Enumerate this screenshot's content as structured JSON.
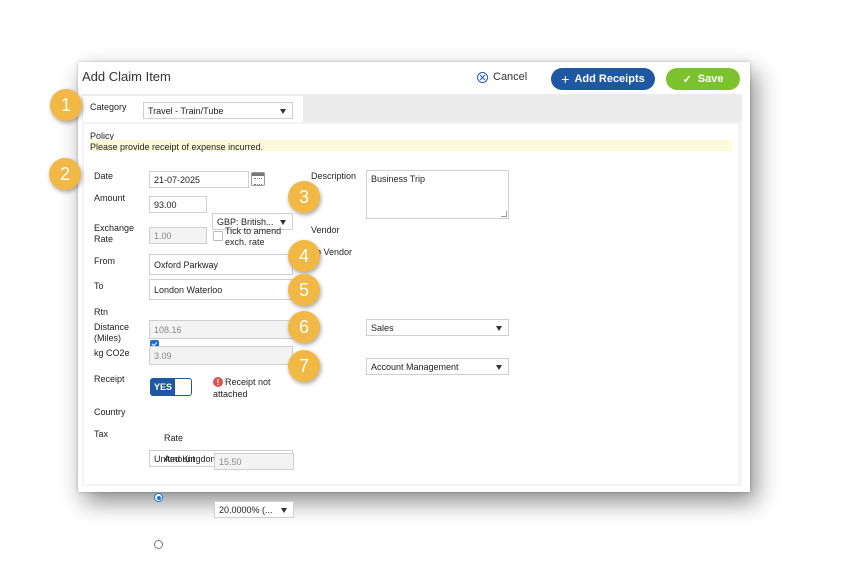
{
  "dialog": {
    "title": "Add Claim Item",
    "cancel_label": "Cancel",
    "add_receipts_label": "Add Receipts",
    "save_label": "Save",
    "accent_blue": "#1d58a0",
    "accent_green": "#7cc22d"
  },
  "category": {
    "label": "Category",
    "value": "Travel - Train/Tube"
  },
  "policy": {
    "label": "Policy",
    "text": "Please provide receipt of expense incurred."
  },
  "form": {
    "date_label": "Date",
    "date_value": "21-07-2025",
    "amount_label": "Amount",
    "amount_value": "93.00",
    "currency_value": "GBP: British...",
    "exchange_label_1": "Exchange",
    "exchange_label_2": "Rate",
    "exchange_value": "1.00",
    "tick_label_1": "Tick to amend",
    "tick_label_2": "exch. rate",
    "from_label": "From",
    "from_value": "Oxford Parkway",
    "to_label": "To",
    "to_value": "London Waterloo",
    "rtn_label": "Rtn",
    "rtn_checked": true,
    "distance_label_1": "Distance",
    "distance_label_2": "(Miles)",
    "distance_value": "108.16",
    "co2_label": "kg CO2e",
    "co2_value": "3.09",
    "receipt_label": "Receipt",
    "receipt_toggle": "YES",
    "receipt_warning_1": "Receipt not",
    "receipt_warning_2": "attached",
    "country_label": "Country",
    "country_value": "United Kingdom",
    "tax_label": "Tax",
    "tax_rate_label": "Rate",
    "tax_rate_value": "20.0000% (...",
    "tax_amount_label": "Amount",
    "tax_amount_value": "15.50",
    "description_label": "Description",
    "description_value": "Business Trip",
    "vendor_label": "Vendor",
    "vendor_value": "Sales",
    "subvendor_label": "ub Vendor",
    "subvendor_value": "Account Management"
  },
  "callouts": [
    "1",
    "2",
    "3",
    "4",
    "5",
    "6",
    "7"
  ],
  "callout_color": "#f2b846"
}
